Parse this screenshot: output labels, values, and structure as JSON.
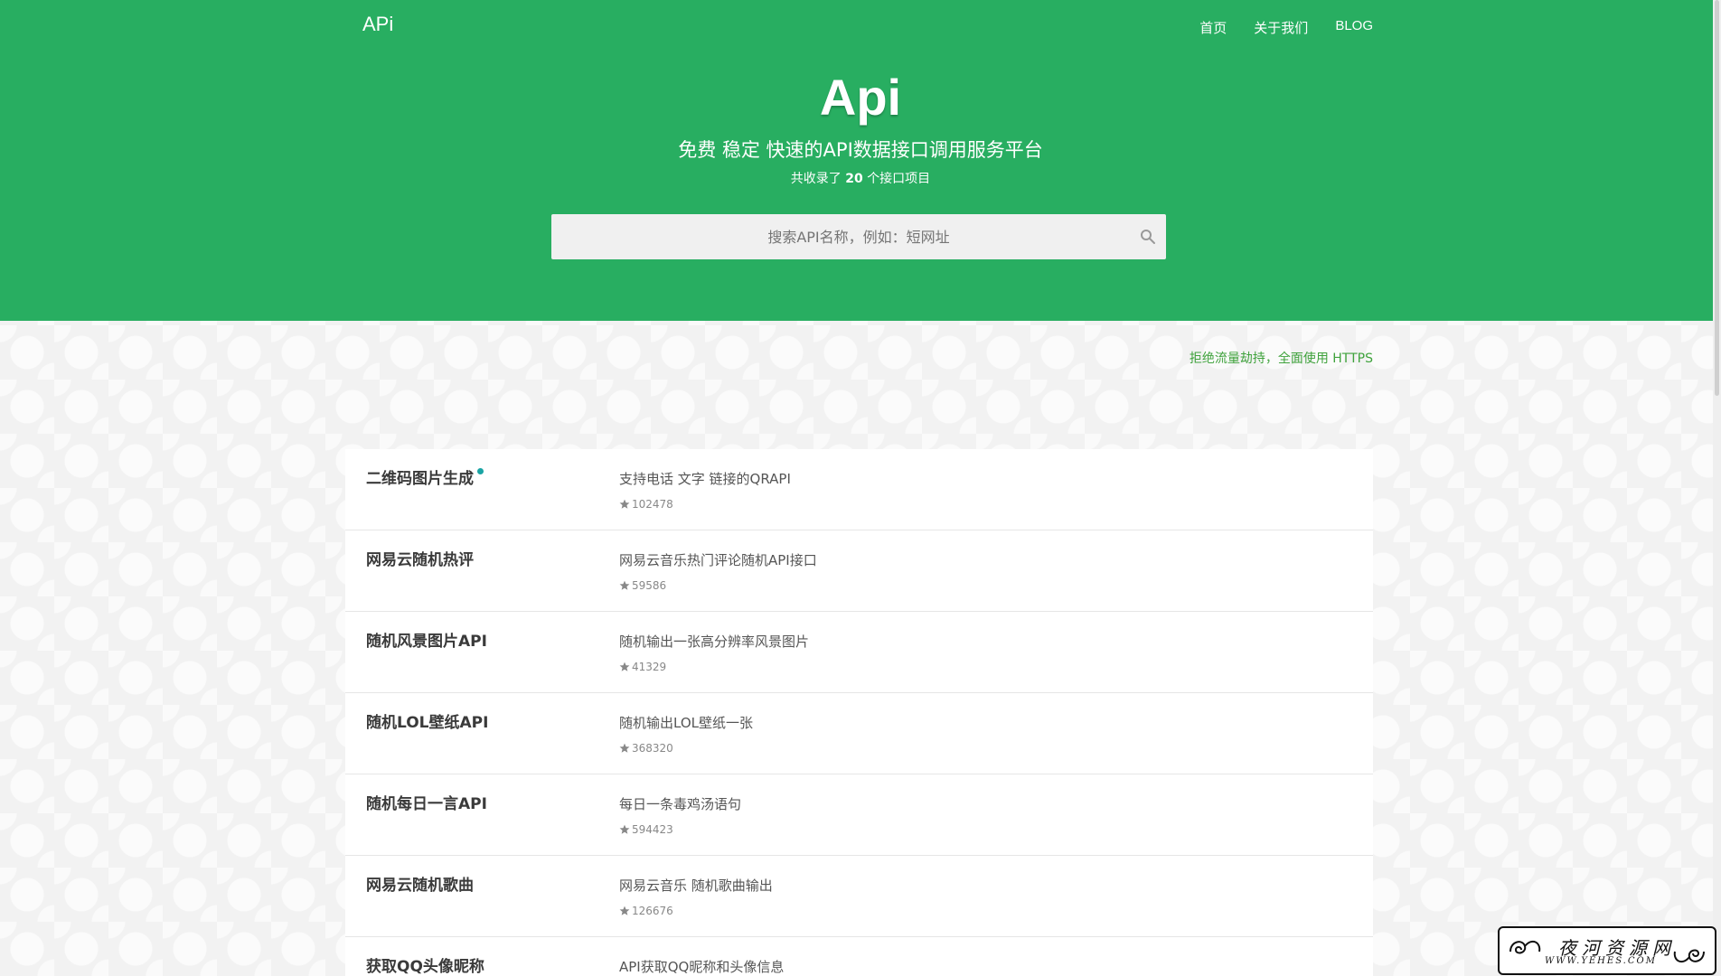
{
  "nav": {
    "brand": "APi",
    "items": [
      "首页",
      "关于我们",
      "BLOG"
    ]
  },
  "hero": {
    "title": "Api",
    "subtitle": "免费 稳定 快速的API数据接口调用服务平台",
    "count_prefix": "共收录了",
    "count_value": "20",
    "count_suffix": "个接口项目"
  },
  "search": {
    "placeholder": "搜索API名称，例如：短网址"
  },
  "notice": "拒绝流量劫持，全面使用 HTTPS",
  "apis": [
    {
      "name": "二维码图片生成",
      "desc": "支持电话 文字 链接的QRAPI",
      "stars": "102478",
      "dot": true
    },
    {
      "name": "网易云随机热评",
      "desc": "网易云音乐热门评论随机API接口",
      "stars": "59586",
      "dot": false
    },
    {
      "name": "随机风景图片API",
      "desc": "随机输出一张高分辨率风景图片",
      "stars": "41329",
      "dot": false
    },
    {
      "name": "随机LOL壁纸API",
      "desc": "随机输出LOL壁纸一张",
      "stars": "368320",
      "dot": false
    },
    {
      "name": "随机每日一言API",
      "desc": "每日一条毒鸡汤语句",
      "stars": "594423",
      "dot": false
    },
    {
      "name": "网易云随机歌曲",
      "desc": "网易云音乐 随机歌曲输出",
      "stars": "126676",
      "dot": false
    },
    {
      "name": "获取QQ头像昵称",
      "desc": "API获取QQ昵称和头像信息",
      "stars": "",
      "dot": false
    }
  ],
  "watermark": {
    "cn": "夜河资源网",
    "en": "WWW.YEHES.COM"
  },
  "colors": {
    "header_green": "#28ae61",
    "notice_green": "#3fa23c",
    "dot_teal": "#1aa4a4"
  }
}
